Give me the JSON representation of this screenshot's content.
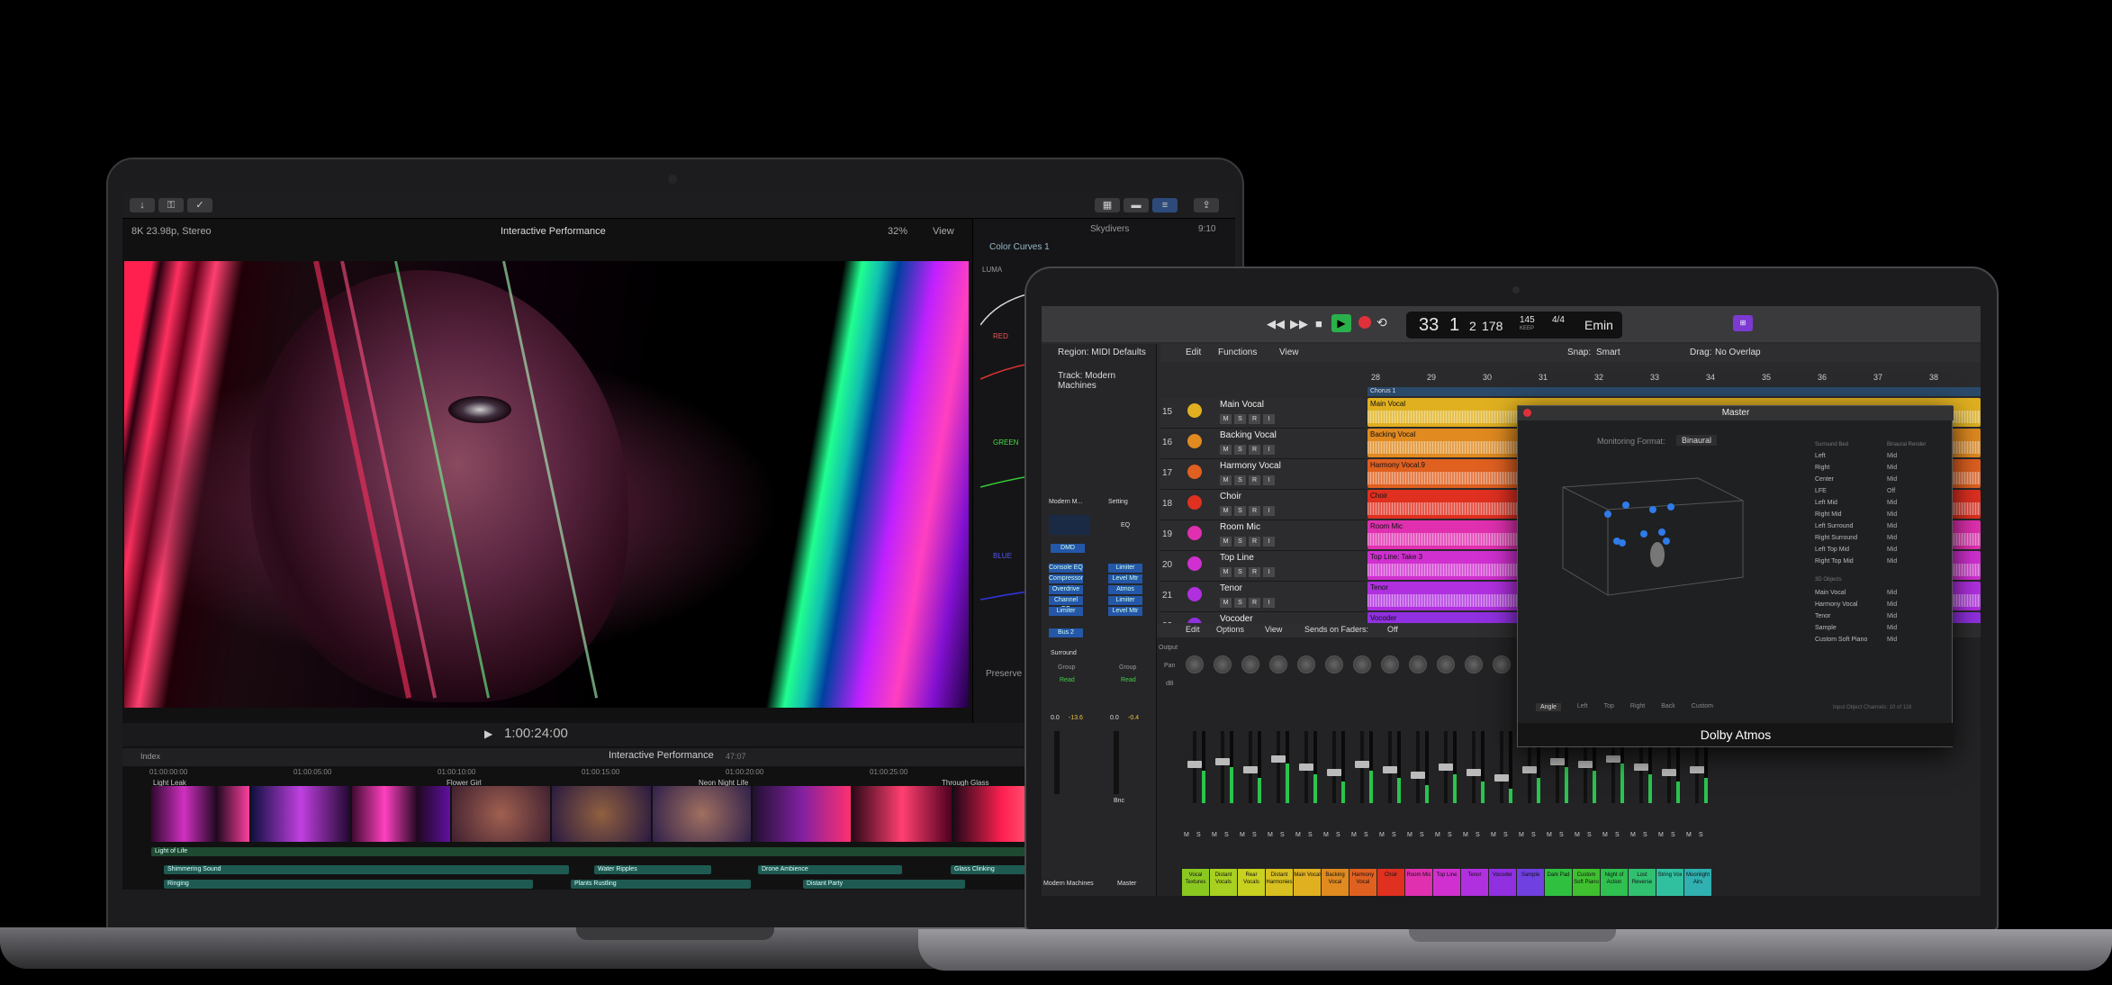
{
  "fcp": {
    "format": "8K 23.98p, Stereo",
    "project_title": "Interactive Performance",
    "zoom": "32%",
    "view_label": "View",
    "library": "Skydivers",
    "library_time": "9:10",
    "effect": "Color Curves 1",
    "luma_label": "LUMA",
    "red_label": "RED",
    "green_label": "GREEN",
    "blue_label": "BLUE",
    "preserve_label": "Preserve L",
    "timecode": "1:00:24:00",
    "index_label": "Index",
    "timeline_title": "Interactive Performance",
    "timeline_duration": "47:07",
    "ruler": [
      "01:00:00:00",
      "01:00:05:00",
      "01:00:10:00",
      "01:00:15:00",
      "01:00:20:00",
      "01:00:25:00"
    ],
    "clips": [
      "Light Leak",
      "Flower Girl",
      "Neon Night Life",
      "Through Glass"
    ],
    "audio": [
      {
        "name": "Light of Life"
      },
      {
        "name": "Shimmering Sound"
      },
      {
        "name": "Water Ripples"
      },
      {
        "name": "Drone Ambience"
      },
      {
        "name": "Glass Clinking"
      },
      {
        "name": "Ringing"
      },
      {
        "name": "Plants Rustling"
      },
      {
        "name": "Distant Party"
      }
    ],
    "toolbar_icons": [
      "import-icon",
      "key-icon",
      "check-icon",
      "share-icon"
    ]
  },
  "logic": {
    "lcd": {
      "bar": "33",
      "beat": "1",
      "division": "2",
      "tick": "178",
      "tempo": "145",
      "tempo_label": "KEEP",
      "time_sig": "4/4",
      "key": "Emin"
    },
    "region_label": "Region: MIDI Defaults",
    "track_label": "Track: Modern Machines",
    "edit_label": "Edit",
    "functions_label": "Functions",
    "view_label": "View",
    "snap_label": "Snap:",
    "snap_value": "Smart",
    "drag_label": "Drag:",
    "drag_value": "No Overlap",
    "bars": [
      "28",
      "29",
      "30",
      "31",
      "32",
      "33",
      "34",
      "35",
      "36",
      "37",
      "38"
    ],
    "marker": "Chorus 1",
    "tracks": [
      {
        "num": "15",
        "name": "Main Vocal",
        "color": "#e0b020"
      },
      {
        "num": "16",
        "name": "Backing Vocal",
        "color": "#e08a20"
      },
      {
        "num": "17",
        "name": "Harmony Vocal",
        "color": "#e06020"
      },
      {
        "num": "18",
        "name": "Choir",
        "color": "#e03020"
      },
      {
        "num": "19",
        "name": "Room Mic",
        "color": "#e030b0"
      },
      {
        "num": "20",
        "name": "Top Line",
        "color": "#d030d0"
      },
      {
        "num": "21",
        "name": "Tenor",
        "color": "#b030e0"
      },
      {
        "num": "22",
        "name": "Vocoder",
        "color": "#9030e0"
      }
    ],
    "regions": [
      {
        "label": "Main Vocal"
      },
      {
        "label": "Backing Vocal"
      },
      {
        "label": "Harmony Vocal.9"
      },
      {
        "label": "Choir"
      },
      {
        "label": "Room Mic"
      },
      {
        "label": "Top Line: Take 3"
      },
      {
        "label": "Tenor"
      },
      {
        "label": "Vocoder"
      }
    ],
    "inspector": {
      "left_name": "Modern M...",
      "right_name": "Setting",
      "eq_label": "EQ",
      "dmd": "DMD",
      "plugins_left": [
        "Console EQ",
        "Compressor",
        "Overdrive",
        "Channel EQ",
        "Limiter"
      ],
      "plugins_right": [
        "Limiter",
        "Level Mtr",
        "Atmos",
        "Limiter",
        "Level Mtr"
      ],
      "bus": "Bus 2",
      "output": "Surround",
      "group": "Group",
      "read": "Read",
      "vol_left": "0.0",
      "vol_left_peak": "-13.6",
      "vol_right": "0.0",
      "vol_right_peak": "-0.4",
      "bottom_left": "Modern Machines",
      "bottom_right": "Master",
      "bnc": "Bnc"
    },
    "mixer": {
      "edit": "Edit",
      "options": "Options",
      "view": "View",
      "sends_label": "Sends on Faders:",
      "sends_value": "Off",
      "row_output": "Output",
      "row_pan": "Pan",
      "row_db": "dB"
    },
    "channels": [
      {
        "name": "Vocal Textures",
        "color": "#8ac820",
        "level": 0.45
      },
      {
        "name": "Distant Vocals",
        "color": "#a8d020",
        "level": 0.5
      },
      {
        "name": "Rear Vocals",
        "color": "#c8d020",
        "level": 0.35
      },
      {
        "name": "Distant Harmonies",
        "color": "#d8c020",
        "level": 0.55
      },
      {
        "name": "Main Vocal",
        "color": "#e0b020",
        "level": 0.4
      },
      {
        "name": "Backing Vocal",
        "color": "#e08a20",
        "level": 0.3
      },
      {
        "name": "Harmony Vocal",
        "color": "#e06020",
        "level": 0.45
      },
      {
        "name": "Choir",
        "color": "#e03020",
        "level": 0.35
      },
      {
        "name": "Room Mic",
        "color": "#e030b0",
        "level": 0.25
      },
      {
        "name": "Top Line",
        "color": "#d030d0",
        "level": 0.4
      },
      {
        "name": "Tenor",
        "color": "#b030e0",
        "level": 0.3
      },
      {
        "name": "Vocoder",
        "color": "#9030e0",
        "level": 0.2
      },
      {
        "name": "Sample",
        "color": "#7040e0",
        "level": 0.35
      },
      {
        "name": "Dark Pad",
        "color": "#30c040",
        "level": 0.5
      },
      {
        "name": "Custom Soft Piano",
        "color": "#40c030",
        "level": 0.45
      },
      {
        "name": "Night of Action",
        "color": "#30c050",
        "level": 0.55
      },
      {
        "name": "Lost Reverse",
        "color": "#30c070",
        "level": 0.4
      },
      {
        "name": "String Vox",
        "color": "#30c0a0",
        "level": 0.3
      },
      {
        "name": "Moonlight Airs",
        "color": "#30b0b0",
        "level": 0.35
      }
    ],
    "atmos": {
      "title": "Master",
      "monitoring_label": "Monitoring Format:",
      "monitoring_value": "Binaural",
      "header_bed": "Surround Bed",
      "header_render": "Binaural Render",
      "beds": [
        {
          "name": "Left",
          "val": "Mid"
        },
        {
          "name": "Right",
          "val": "Mid"
        },
        {
          "name": "Center",
          "val": "Mid"
        },
        {
          "name": "LFE",
          "val": "Off"
        },
        {
          "name": "Left Mid",
          "val": "Mid"
        },
        {
          "name": "Right Mid",
          "val": "Mid"
        },
        {
          "name": "Left Surround",
          "val": "Mid"
        },
        {
          "name": "Right Surround",
          "val": "Mid"
        },
        {
          "name": "Left Top Mid",
          "val": "Mid"
        },
        {
          "name": "Right Top Mid",
          "val": "Mid"
        }
      ],
      "objects_header": "3D Objects",
      "objects": [
        {
          "name": "Main Vocal",
          "val": "Mid"
        },
        {
          "name": "Harmony Vocal",
          "val": "Mid"
        },
        {
          "name": "Tenor",
          "val": "Mid"
        },
        {
          "name": "Sample",
          "val": "Mid"
        },
        {
          "name": "Custom Soft Piano",
          "val": "Mid"
        }
      ],
      "tabs": [
        "Angle",
        "Left",
        "Top",
        "Right",
        "Back",
        "Custom"
      ],
      "footer_note": "Input Object Channels: 10 of 118",
      "brand": "Dolby Atmos"
    }
  }
}
